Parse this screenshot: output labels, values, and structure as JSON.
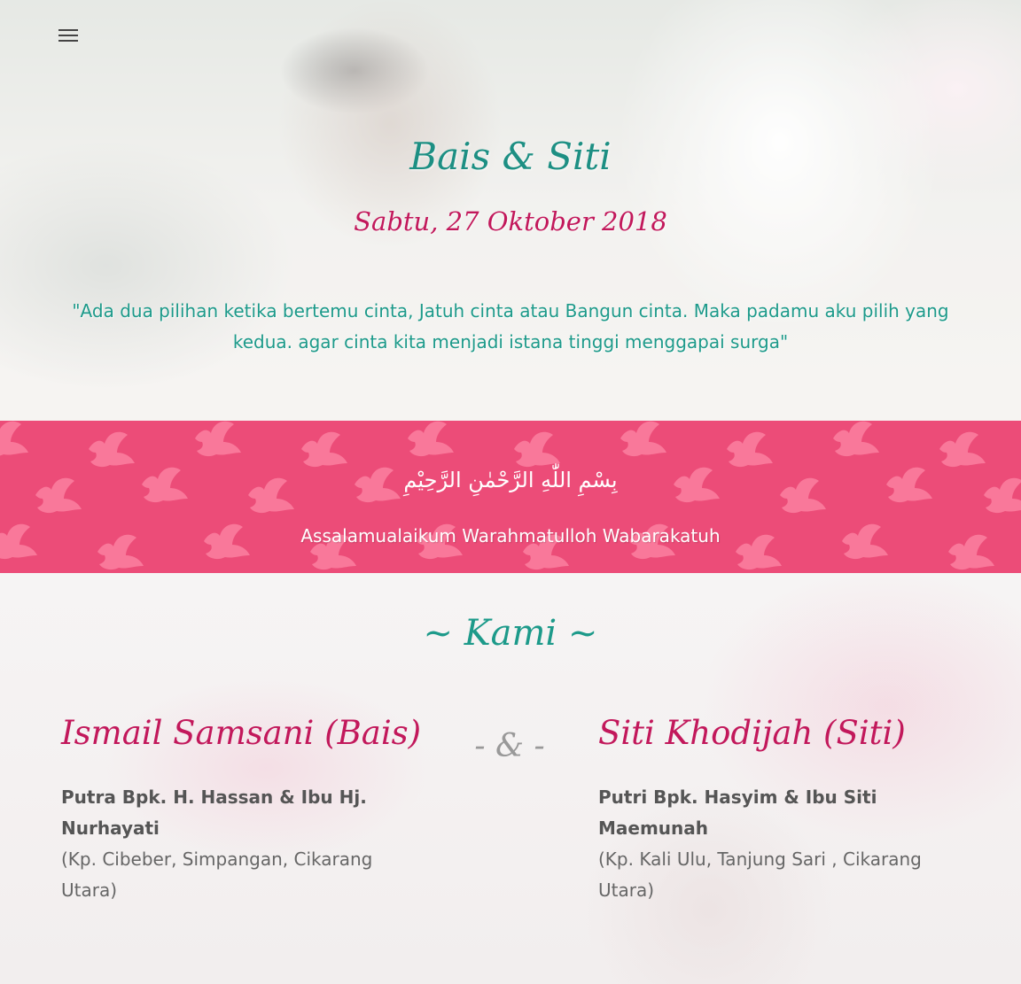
{
  "hero": {
    "couple_title": "Bais & Siti",
    "date": "Sabtu, 27 Oktober 2018",
    "quote": "\"Ada dua pilihan ketika bertemu cinta, Jatuh cinta atau Bangun cinta. Maka padamu aku pilih yang kedua. agar cinta kita menjadi istana tinggi menggapai surga\""
  },
  "menu": {
    "icon": "hamburger-menu-icon"
  },
  "banner": {
    "bismillah": "بِسْمِ اللّٰهِ الرَّحْمٰنِ الرَّحِيْمِ",
    "salam": "Assalamualaikum Warahmatulloh Wabarakatuh",
    "background_color": "#ec4c78",
    "pattern_color": "#f9789a"
  },
  "kami": {
    "heading": "~ Kami ~",
    "separator": "- & -",
    "groom": {
      "name": "Ismail Samsani (Bais)",
      "parents": "Putra Bpk. H. Hassan & Ibu Hj. Nurhayati",
      "address": "(Kp. Cibeber, Simpangan, Cikarang Utara)"
    },
    "bride": {
      "name": "Siti Khodijah (Siti)",
      "parents": "Putri Bpk. Hasyim & Ibu Siti Maemunah",
      "address": "(Kp. Kali Ulu, Tanjung Sari , Cikarang Utara)"
    }
  },
  "colors": {
    "teal": "#1d9a8a",
    "magenta": "#c2185b",
    "pink": "#ec4c78"
  }
}
